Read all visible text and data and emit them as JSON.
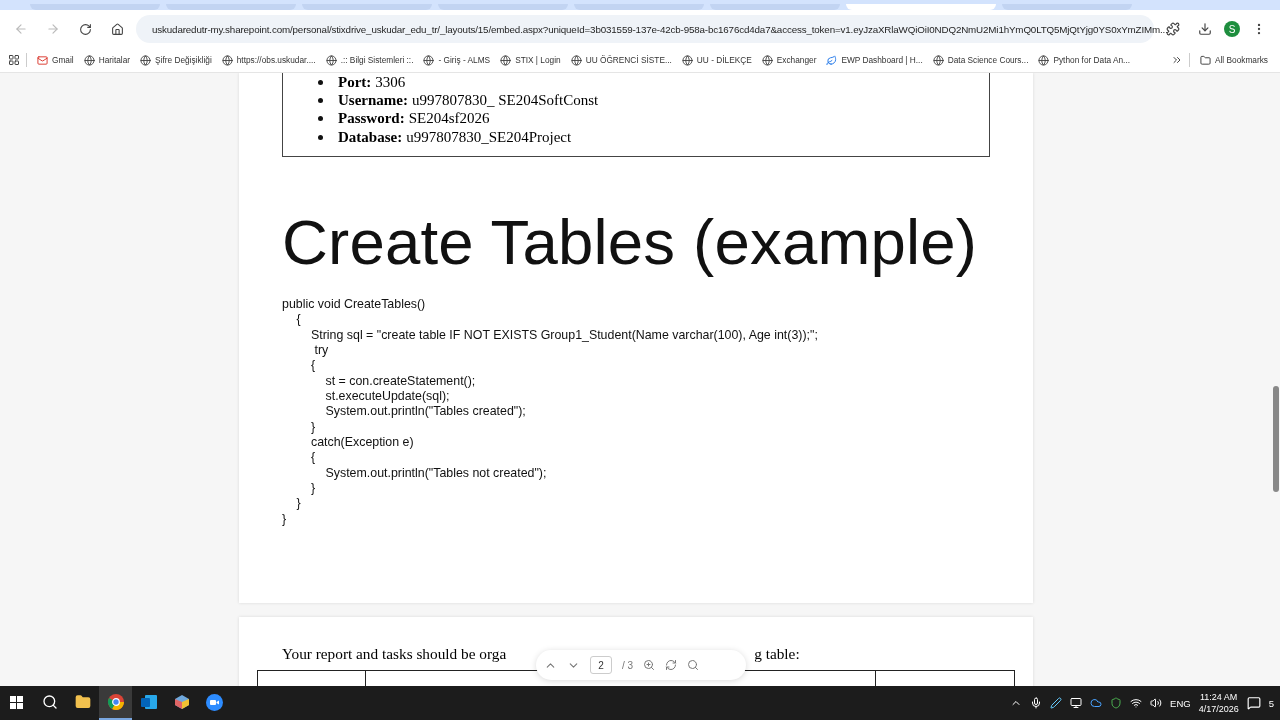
{
  "browser": {
    "url": "uskudaredutr-my.sharepoint.com/personal/stixdrive_uskudar_edu_tr/_layouts/15/embed.aspx?uniqueId=3b031559-137e-42cb-958a-bc1676cd4da7&access_token=v1.eyJzaXRlaWQiOiI0NDQ2NmU2Mi1hYmQ0LTQ5MjQtYjg0YS0xYmZIMm...",
    "profile": "S",
    "bookmarks": [
      {
        "label": "Gmail",
        "kind": "mail"
      },
      {
        "label": "Haritalar",
        "kind": "globe"
      },
      {
        "label": "Şifre Değişikliği",
        "kind": "globe"
      },
      {
        "label": "https://obs.uskudar....",
        "kind": "globe"
      },
      {
        "label": ".:: Bilgi Sistemleri ::.",
        "kind": "globe"
      },
      {
        "label": "- Giriş - ALMS",
        "kind": "globe"
      },
      {
        "label": "STIX | Login",
        "kind": "globe"
      },
      {
        "label": "UU ÖĞRENCİ SİSTE...",
        "kind": "globe"
      },
      {
        "label": "UU - DİLEKÇE",
        "kind": "globe"
      },
      {
        "label": "Exchanger",
        "kind": "globe"
      },
      {
        "label": "EWP Dashboard | H...",
        "kind": "leaf"
      },
      {
        "label": "Data Science Cours...",
        "kind": "globe"
      },
      {
        "label": "Python for Data An...",
        "kind": "globe"
      }
    ],
    "all_bookmarks": "All Bookmarks"
  },
  "document": {
    "credentials": [
      {
        "label": "Port:",
        "value": "3306"
      },
      {
        "label": "Username:",
        "value": "u997807830_ SE204SoftConst"
      },
      {
        "label": "Password:",
        "value": "SE204sf2026"
      },
      {
        "label": "Database:",
        "value": "u997807830_SE204Project"
      }
    ],
    "heading": "Create Tables (example)",
    "code": [
      {
        "text": "public void CreateTables()",
        "children": [
          {
            "text": "{",
            "children": [
              {
                "text": "String sql = \"create table IF NOT EXISTS Group1_Student(Name varchar(100), Age int(3));\";"
              },
              {
                "text": " try"
              },
              {
                "text": "{",
                "children": [
                  {
                    "text": "st = con.createStatement();"
                  },
                  {
                    "text": "st.executeUpdate(sql);"
                  },
                  {
                    "text": "System.out.println(\"Tables created\");"
                  }
                ]
              },
              {
                "text": "}"
              },
              {
                "text": "catch(Exception e)"
              },
              {
                "text": "{",
                "children": [
                  {
                    "text": "System.out.println(\"Tables not created\");"
                  }
                ]
              },
              {
                "text": "}"
              }
            ]
          },
          {
            "text": "}"
          }
        ]
      },
      {
        "text": "}"
      }
    ],
    "next_page_text_before": "Your report and tasks should be orga",
    "next_page_text_after": "g table:"
  },
  "pdf_toolbar": {
    "page": "2",
    "total": "/ 3"
  },
  "taskbar": {
    "language": "ENG",
    "time": "11:24 AM",
    "date": "4/17/2026",
    "notifications": "5"
  }
}
